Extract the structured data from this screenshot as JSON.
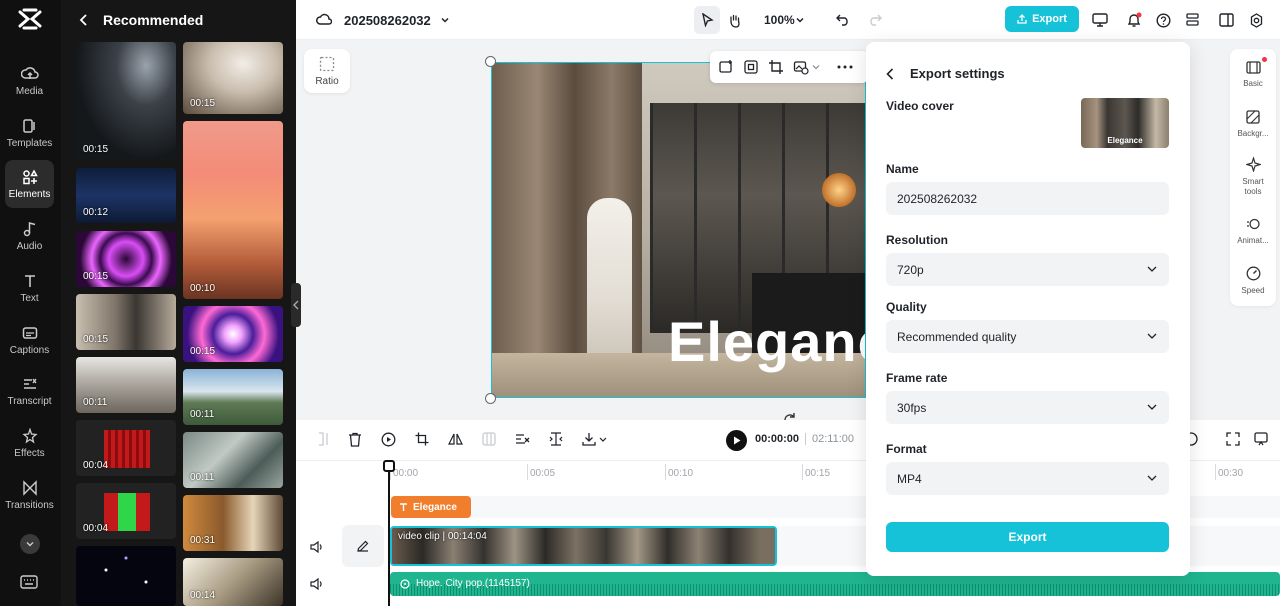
{
  "sidebar": {
    "items": [
      {
        "label": "Media",
        "icon": "media-cloud-icon"
      },
      {
        "label": "Templates",
        "icon": "templates-icon"
      },
      {
        "label": "Elements",
        "icon": "elements-icon"
      },
      {
        "label": "Audio",
        "icon": "music-note-icon"
      },
      {
        "label": "Text",
        "icon": "text-t-icon"
      },
      {
        "label": "Captions",
        "icon": "captions-icon"
      },
      {
        "label": "Transcript",
        "icon": "transcript-icon"
      },
      {
        "label": "Effects",
        "icon": "effects-sparkle-icon"
      },
      {
        "label": "Transitions",
        "icon": "transitions-icon"
      }
    ],
    "active": "Elements"
  },
  "panel": {
    "title": "Recommended",
    "left_col": [
      "00:15",
      "00:12",
      "00:15",
      "00:15",
      "00:11",
      "00:04",
      "00:04"
    ],
    "right_col": [
      "00:15",
      "00:10",
      "00:15",
      "00:11",
      "00:11",
      "00:31",
      "00:14"
    ]
  },
  "topbar": {
    "project_name": "202508262032",
    "zoom": "100%",
    "export_label": "Export"
  },
  "stage": {
    "ratio_label": "Ratio",
    "overlay_text": "Elegance"
  },
  "right_rail": [
    {
      "label": "Basic"
    },
    {
      "label": "Backgr..."
    },
    {
      "label": "Smart tools"
    },
    {
      "label": "Animat..."
    },
    {
      "label": "Speed"
    }
  ],
  "timeline": {
    "current_time": "00:00:00",
    "total_time": "02:11:00",
    "ruler": [
      "00:00",
      "00:05",
      "00:10",
      "00:15",
      "00:30"
    ],
    "text_clip": "Elegance",
    "video_clip_label": "video clip",
    "video_clip_duration": "00:14:04",
    "audio_clip": "Hope. City pop.(1145157)"
  },
  "export_modal": {
    "title": "Export settings",
    "video_cover_label": "Video cover",
    "cover_caption": "Elegance",
    "name_label": "Name",
    "name_value": "202508262032",
    "resolution_label": "Resolution",
    "resolution_value": "720p",
    "quality_label": "Quality",
    "quality_value": "Recommended quality",
    "frame_rate_label": "Frame rate",
    "frame_rate_value": "30fps",
    "format_label": "Format",
    "format_value": "MP4",
    "export_button": "Export"
  },
  "colors": {
    "accent": "#15c2d8",
    "text_clip": "#f07e2c",
    "audio_clip": "#1fb58f",
    "rail_bg": "#101010",
    "panel_bg": "#161616"
  }
}
